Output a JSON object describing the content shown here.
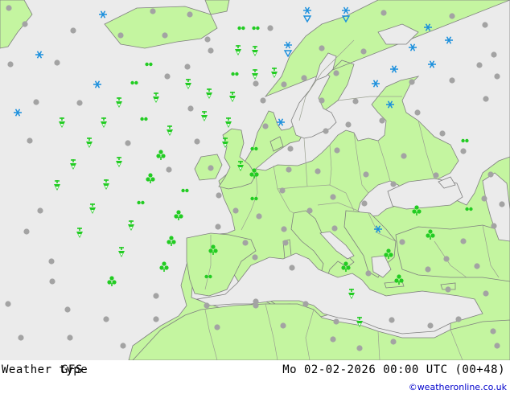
{
  "footer": {
    "title": "Weather type",
    "model": "GFS",
    "datetime": "Mo 02-02-2026 00:00 UTC (00+48)",
    "credit": "©weatheronline.co.uk"
  },
  "colors": {
    "sea": "#ebebeb",
    "land": "#c4f5a0",
    "border": "#9aa090",
    "coast": "#7f7f7f",
    "rain": "#22cc22",
    "snow": "#1a8fdd",
    "cloud": "#a3a3a3",
    "credit": "#0000cc"
  },
  "icon_legend": [
    "cloudy-dot-icon",
    "rain-icon",
    "showers-icon",
    "drizzle-icon",
    "snow-icon",
    "snow-shower-icon"
  ]
}
